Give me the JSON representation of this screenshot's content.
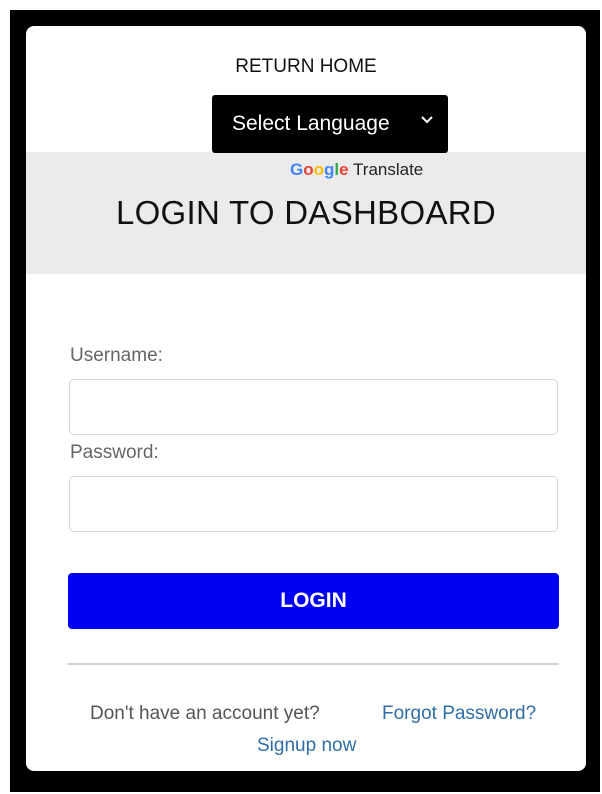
{
  "header": {
    "return_home": "RETURN HOME",
    "language_select": "Select Language",
    "translate_brand": [
      "G",
      "o",
      "o",
      "g",
      "l",
      "e"
    ],
    "translate_label": "Translate",
    "title": "LOGIN TO DASHBOARD"
  },
  "form": {
    "username_label": "Username:",
    "username_value": "",
    "password_label": "Password:",
    "password_value": "",
    "login_label": "LOGIN"
  },
  "footer": {
    "no_account_text": "Don't have an account yet?",
    "forgot_password": "Forgot Password?",
    "signup": "Signup now"
  },
  "colors": {
    "login_button": "#0000f5",
    "link": "#2f6ea8",
    "frame": "#000000",
    "header_band": "#ebebeb"
  }
}
